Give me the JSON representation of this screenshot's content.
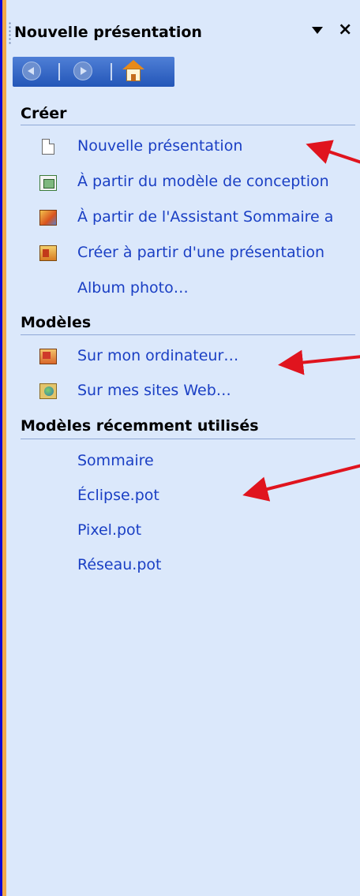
{
  "panel": {
    "title": "Nouvelle présentation",
    "dropdown_icon": "chevron-down-icon",
    "close_label": "×"
  },
  "nav": {
    "back_icon": "back-arrow-icon",
    "forward_icon": "forward-arrow-icon",
    "home_icon": "home-icon"
  },
  "sections": {
    "creer": {
      "heading": "Créer",
      "items": [
        {
          "label": "Nouvelle présentation",
          "icon": "blank-document-icon"
        },
        {
          "label": "À partir du modèle de conception",
          "icon": "design-template-icon"
        },
        {
          "label": "À partir de l'Assistant Sommaire a",
          "icon": "wizard-icon"
        },
        {
          "label": "Créer à partir d'une présentation",
          "icon": "existing-presentation-icon"
        },
        {
          "label": "Album photo…",
          "icon": ""
        }
      ]
    },
    "modeles": {
      "heading": "Modèles",
      "items": [
        {
          "label": "Sur mon ordinateur…",
          "icon": "computer-templates-icon"
        },
        {
          "label": "Sur mes sites Web…",
          "icon": "web-templates-icon"
        }
      ]
    },
    "recents": {
      "heading": "Modèles récemment utilisés",
      "items": [
        {
          "label": "Sommaire"
        },
        {
          "label": "Éclipse.pot"
        },
        {
          "label": "Pixel.pot"
        },
        {
          "label": "Réseau.pot"
        }
      ]
    }
  },
  "colors": {
    "background": "#0b07d6",
    "panel": "#dbe8fb",
    "accent_border": "#f2a94a",
    "link": "#1a3fc4",
    "annotation_arrow": "#e0141e"
  }
}
